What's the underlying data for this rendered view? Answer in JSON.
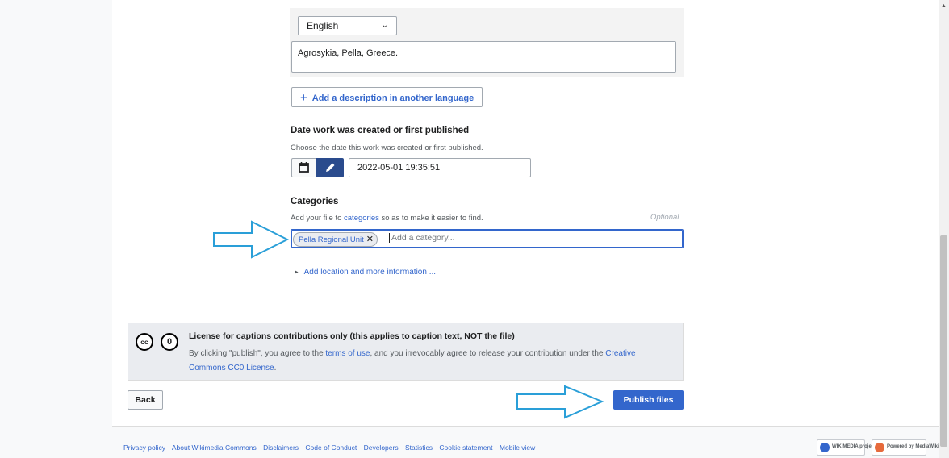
{
  "description": {
    "language": "English",
    "text": "Agrosykia, Pella, Greece.",
    "add_another_label": "Add a description in another language"
  },
  "date": {
    "title": "Date work was created or first published",
    "help": "Choose the date this work was created or first published.",
    "value": "2022-05-01 19:35:51"
  },
  "categories": {
    "title": "Categories",
    "help_prefix": "Add your file to ",
    "help_link": "categories",
    "help_suffix": " so as to make it easier to find.",
    "optional": "Optional",
    "chips": [
      "Pella Regional Unit"
    ],
    "placeholder": "Add a category..."
  },
  "more_info_label": "Add location and more information ...",
  "license": {
    "title": "License for captions contributions only (this applies to caption text, NOT the file)",
    "body_1": "By clicking \"publish\", you agree to the ",
    "terms_link": "terms of use",
    "body_2": ", and you irrevocably agree to release your contribution under the ",
    "license_link_1": "Creative",
    "license_link_2": "Commons CC0 License",
    "body_3": "."
  },
  "actions": {
    "back": "Back",
    "publish": "Publish files"
  },
  "footer": {
    "links": [
      "Privacy policy",
      "About Wikimedia Commons",
      "Disclaimers",
      "Code of Conduct",
      "Developers",
      "Statistics",
      "Cookie statement",
      "Mobile view"
    ],
    "wikimedia_badge": "WIKIMEDIA project",
    "mediawiki_badge": "Powered by MediaWiki"
  },
  "colors": {
    "accent": "#3366cc",
    "annotation_arrow": "#2a9fd8"
  }
}
